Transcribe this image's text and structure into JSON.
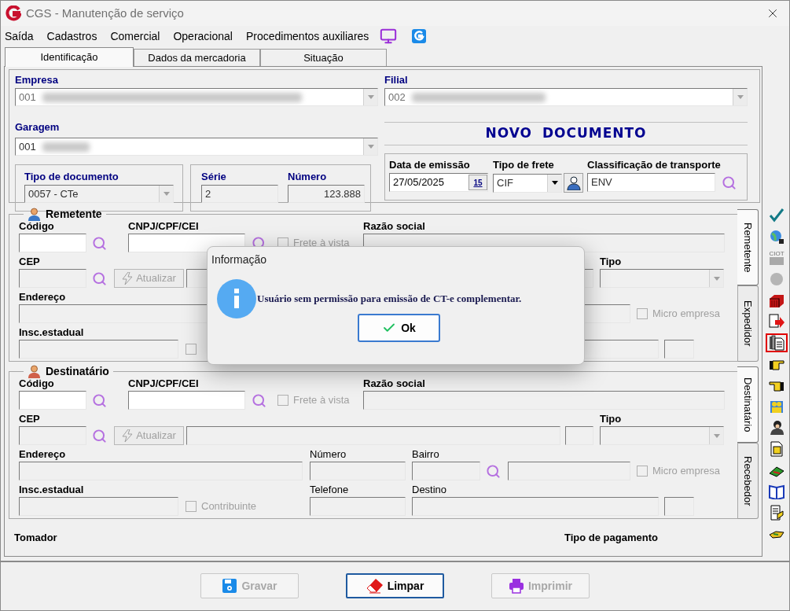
{
  "window": {
    "title": "CGS - Manutenção de serviço"
  },
  "menu": [
    "Saída",
    "Cadastros",
    "Comercial",
    "Operacional",
    "Procedimentos auxiliares"
  ],
  "tabs": [
    {
      "label": "Identificação",
      "selected": true
    },
    {
      "label": "Dados da mercadoria",
      "selected": false
    },
    {
      "label": "Situação",
      "selected": false
    }
  ],
  "header": {
    "empresa": {
      "label": "Empresa",
      "value": "001"
    },
    "filial": {
      "label": "Filial",
      "value": "002"
    },
    "garagem": {
      "label": "Garagem",
      "value": "001"
    },
    "banner": "NOVO DOCUMENTO",
    "tipo_documento": {
      "label": "Tipo de documento",
      "value": "0057 - CTe"
    },
    "serie": {
      "label": "Série",
      "value": "2"
    },
    "numero": {
      "label": "Número",
      "value": "123.888"
    },
    "data_emissao": {
      "label": "Data de emissão",
      "value": "27/05/2025",
      "calendar": "15"
    },
    "tipo_frete": {
      "label": "Tipo de frete",
      "value": "CIF"
    },
    "classificacao": {
      "label": "Classificação de transporte",
      "value": "ENV"
    }
  },
  "parties": [
    {
      "title": "Remetente",
      "color": "#3a78c8",
      "tabs": [
        {
          "label": "Remetente",
          "selected": true
        },
        {
          "label": "Expedidor",
          "selected": false
        }
      ],
      "labels": {
        "codigo": "Código",
        "cnpj": "CNPJ/CPF/CEI",
        "razao_social": "Razão social",
        "cep": "CEP",
        "tipo": "Tipo",
        "endereco": "Endereço",
        "insc_estadual": "Insc.estadual"
      },
      "frete_a_vista": {
        "label": "Frete à vista",
        "checked": false,
        "disabled": true
      },
      "atualizar": {
        "label": "Atualizar",
        "disabled": true
      },
      "micro_empresa": {
        "label": "Micro empresa",
        "checked": false,
        "disabled": true
      },
      "contribuinte": {
        "checked": false,
        "disabled": true
      }
    },
    {
      "title": "Destinatário",
      "color": "#d0604a",
      "tabs": [
        {
          "label": "Destinatário",
          "selected": true
        },
        {
          "label": "Recebedor",
          "selected": false
        }
      ],
      "labels": {
        "codigo": "Código",
        "cnpj": "CNPJ/CPF/CEI",
        "razao_social": "Razão social",
        "cep": "CEP",
        "tipo": "Tipo",
        "endereco": "Endereço",
        "numero": "Número",
        "bairro": "Bairro",
        "insc_estadual": "Insc.estadual",
        "telefone": "Telefone",
        "destino": "Destino"
      },
      "frete_a_vista": {
        "label": "Frete à vista",
        "checked": false,
        "disabled": true
      },
      "atualizar": {
        "label": "Atualizar",
        "disabled": true
      },
      "micro_empresa": {
        "label": "Micro empresa",
        "checked": false,
        "disabled": true
      },
      "contribuinte": {
        "label": "Contribuinte",
        "checked": false,
        "disabled": true
      }
    }
  ],
  "footer": {
    "tomador": "Tomador",
    "tipo_pagamento": "Tipo de pagamento"
  },
  "buttons": [
    {
      "kind": "save",
      "label": "Gravar",
      "disabled": true,
      "focused": false
    },
    {
      "kind": "erase",
      "label": "Limpar",
      "disabled": false,
      "focused": true
    },
    {
      "kind": "print",
      "label": "Imprimir",
      "disabled": true,
      "focused": false
    }
  ],
  "toolbar": [
    {
      "kind": "check",
      "highlighted": false
    },
    {
      "kind": "globe",
      "highlighted": false
    },
    {
      "kind": "card",
      "label": "CIOT",
      "highlighted": false
    },
    {
      "kind": "circle",
      "highlighted": false
    },
    {
      "kind": "container",
      "highlighted": false
    },
    {
      "kind": "export",
      "highlighted": false
    },
    {
      "kind": "documents",
      "highlighted": true
    },
    {
      "kind": "hand-right",
      "highlighted": false
    },
    {
      "kind": "hand-left",
      "highlighted": false
    },
    {
      "kind": "people",
      "highlighted": false
    },
    {
      "kind": "person",
      "highlighted": false
    },
    {
      "kind": "report",
      "highlighted": false
    },
    {
      "kind": "leaf",
      "highlighted": false
    },
    {
      "kind": "book",
      "highlighted": false
    },
    {
      "kind": "notes",
      "highlighted": false
    },
    {
      "kind": "plane",
      "highlighted": false
    }
  ],
  "dialog": {
    "title": "Informação",
    "message": "Usuário sem permissão para emissão de CT-e complementar.",
    "button": "Ok"
  }
}
